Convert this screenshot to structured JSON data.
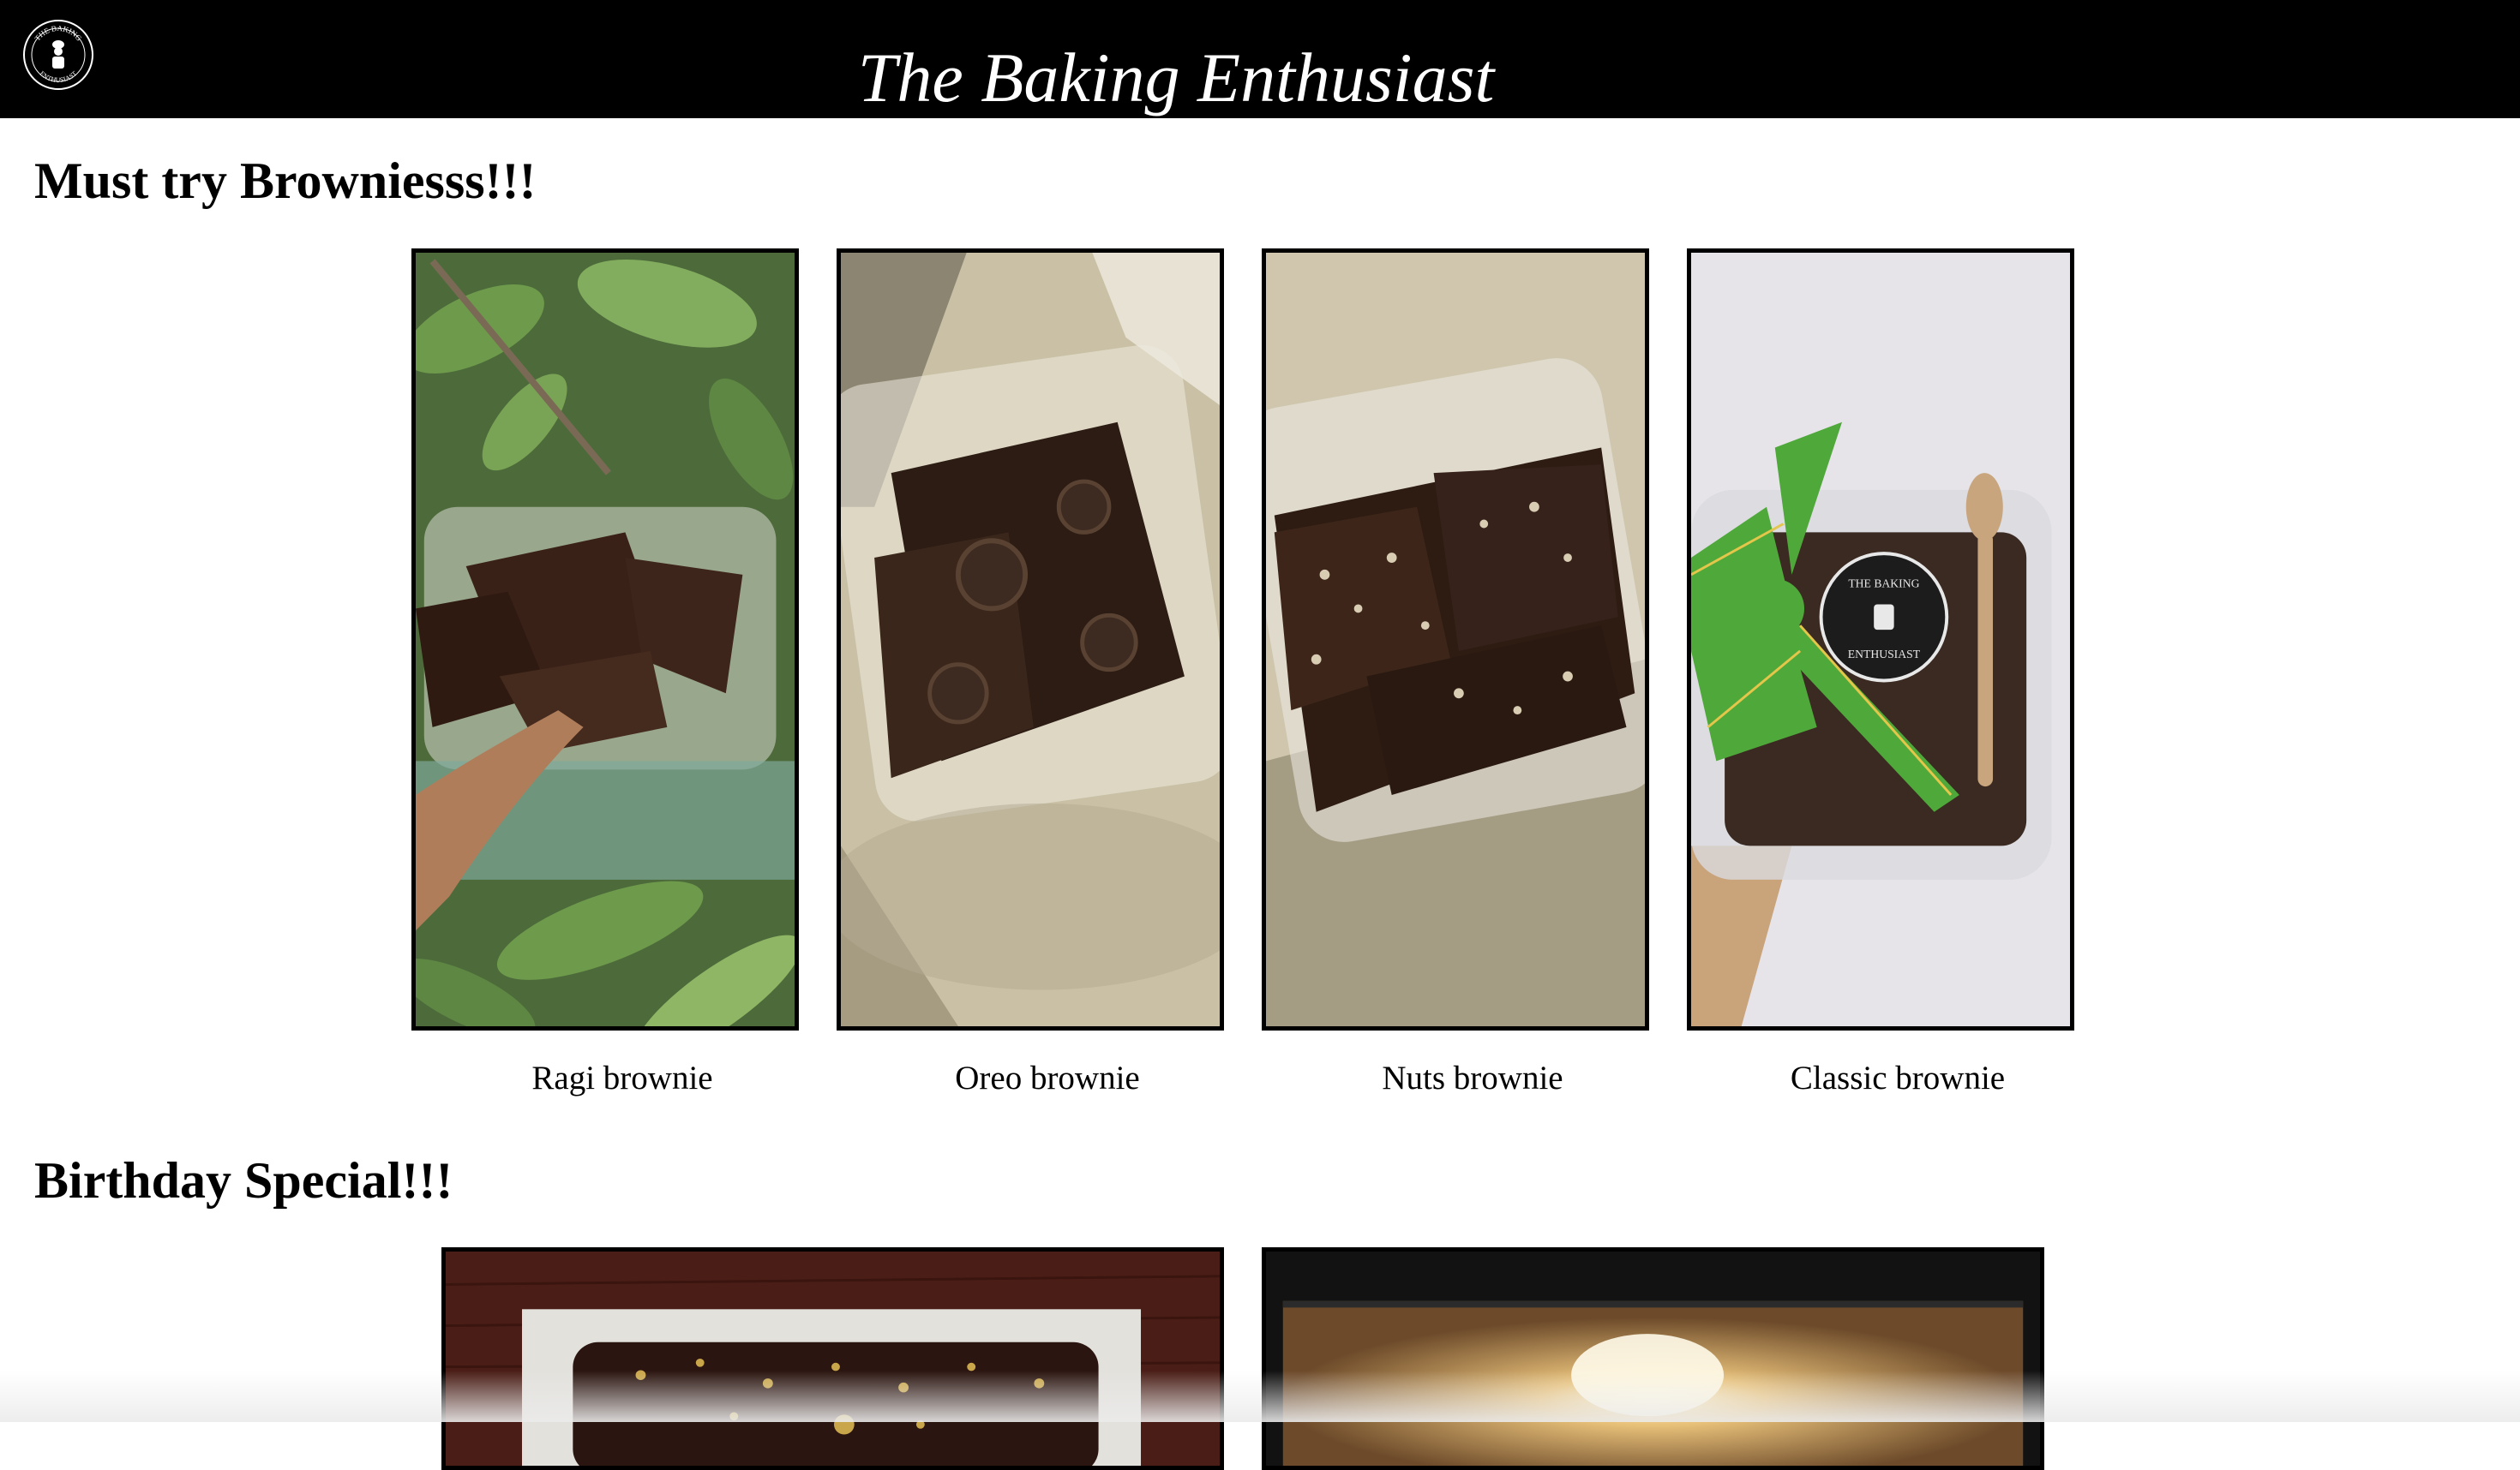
{
  "header": {
    "title": "The Baking Enthusiast",
    "logo_text_top": "THE BAKING",
    "logo_text_bottom": "ENTHUSIAST",
    "background": "#000000",
    "title_color": "#ffffff"
  },
  "sections": [
    {
      "heading": "Must try Browniesss!!!",
      "items": [
        {
          "caption": "Ragi brownie",
          "image": "ragi-brownie-photo"
        },
        {
          "caption": "Oreo brownie",
          "image": "oreo-brownie-photo"
        },
        {
          "caption": "Nuts brownie",
          "image": "nuts-brownie-photo"
        },
        {
          "caption": "Classic brownie",
          "image": "classic-brownie-photo"
        }
      ]
    },
    {
      "heading": "Birthday Special!!!",
      "items": [
        {
          "image": "chocolate-cake-photo"
        },
        {
          "image": "oven-photo"
        }
      ]
    }
  ],
  "package_label_top": "THE BAKING",
  "package_label_bottom": "ENTHUSIAST"
}
